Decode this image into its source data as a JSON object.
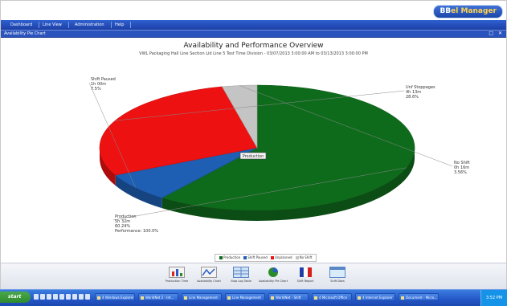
{
  "app": {
    "logo_word": "BB",
    "logo_rest": "el Manager"
  },
  "menubar": {
    "items": [
      "Dashboard",
      "Line View",
      "Administration",
      "Help"
    ]
  },
  "window": {
    "title": "Availability Pie Chart",
    "controls": [
      "□",
      "✕"
    ]
  },
  "chart_data": {
    "type": "pie",
    "title": "Availability and Performance Overview",
    "subtitle": "VWL Packaging Hall Line Section Lid Line 5 Test Time Division - 03/07/2013 3:00:00 AM to 03/13/2013 3:00:00 PM",
    "slices": [
      {
        "label": "Production",
        "lines": [
          "Production",
          "5h 32m",
          "60.24%",
          "Performance: 100.0%"
        ],
        "value": 60.24,
        "color": "#0f6b1c"
      },
      {
        "label": "Shift Paused",
        "lines": [
          "Shift Paused",
          "1h 00m",
          "7.5%"
        ],
        "value": 7.5,
        "color": "#1e5fb3"
      },
      {
        "label": "Unplanned",
        "lines": [
          "Unf Stoppages",
          "4h 13m",
          "28.6%"
        ],
        "value": 28.6,
        "color": "#ee1111"
      },
      {
        "label": "No Shift",
        "lines": [
          "No Shift",
          "0h 16m",
          "3.56%"
        ],
        "value": 3.56,
        "color": "#c4c4c4"
      }
    ],
    "center_label": "Production",
    "legend_position": "bottom-center",
    "legend": [
      {
        "label": "Production",
        "color": "#0f6b1c"
      },
      {
        "label": "Shift Paused",
        "color": "#1e5fb3"
      },
      {
        "label": "Unplanned",
        "color": "#ee1111"
      },
      {
        "label": "No Shift",
        "color": "#c4c4c4"
      }
    ]
  },
  "toolbar": {
    "items": [
      {
        "label": "Production Time"
      },
      {
        "label": "Availability Chart"
      },
      {
        "label": "Stop Log Table"
      },
      {
        "label": "Availability Pie Chart"
      },
      {
        "label": "Shift Report"
      },
      {
        "label": "Shift Data"
      }
    ]
  },
  "taskbar": {
    "start_label": "start",
    "tasks": [
      "4 Windows Explorer",
      "WorldNet 2 - Int...",
      "Line Management",
      "Line Management",
      "WorldNet - Shift",
      "4 Microsoft Office",
      "4 Internet Explorer",
      "Document - Micro..."
    ],
    "clock": "3:52 PM"
  }
}
